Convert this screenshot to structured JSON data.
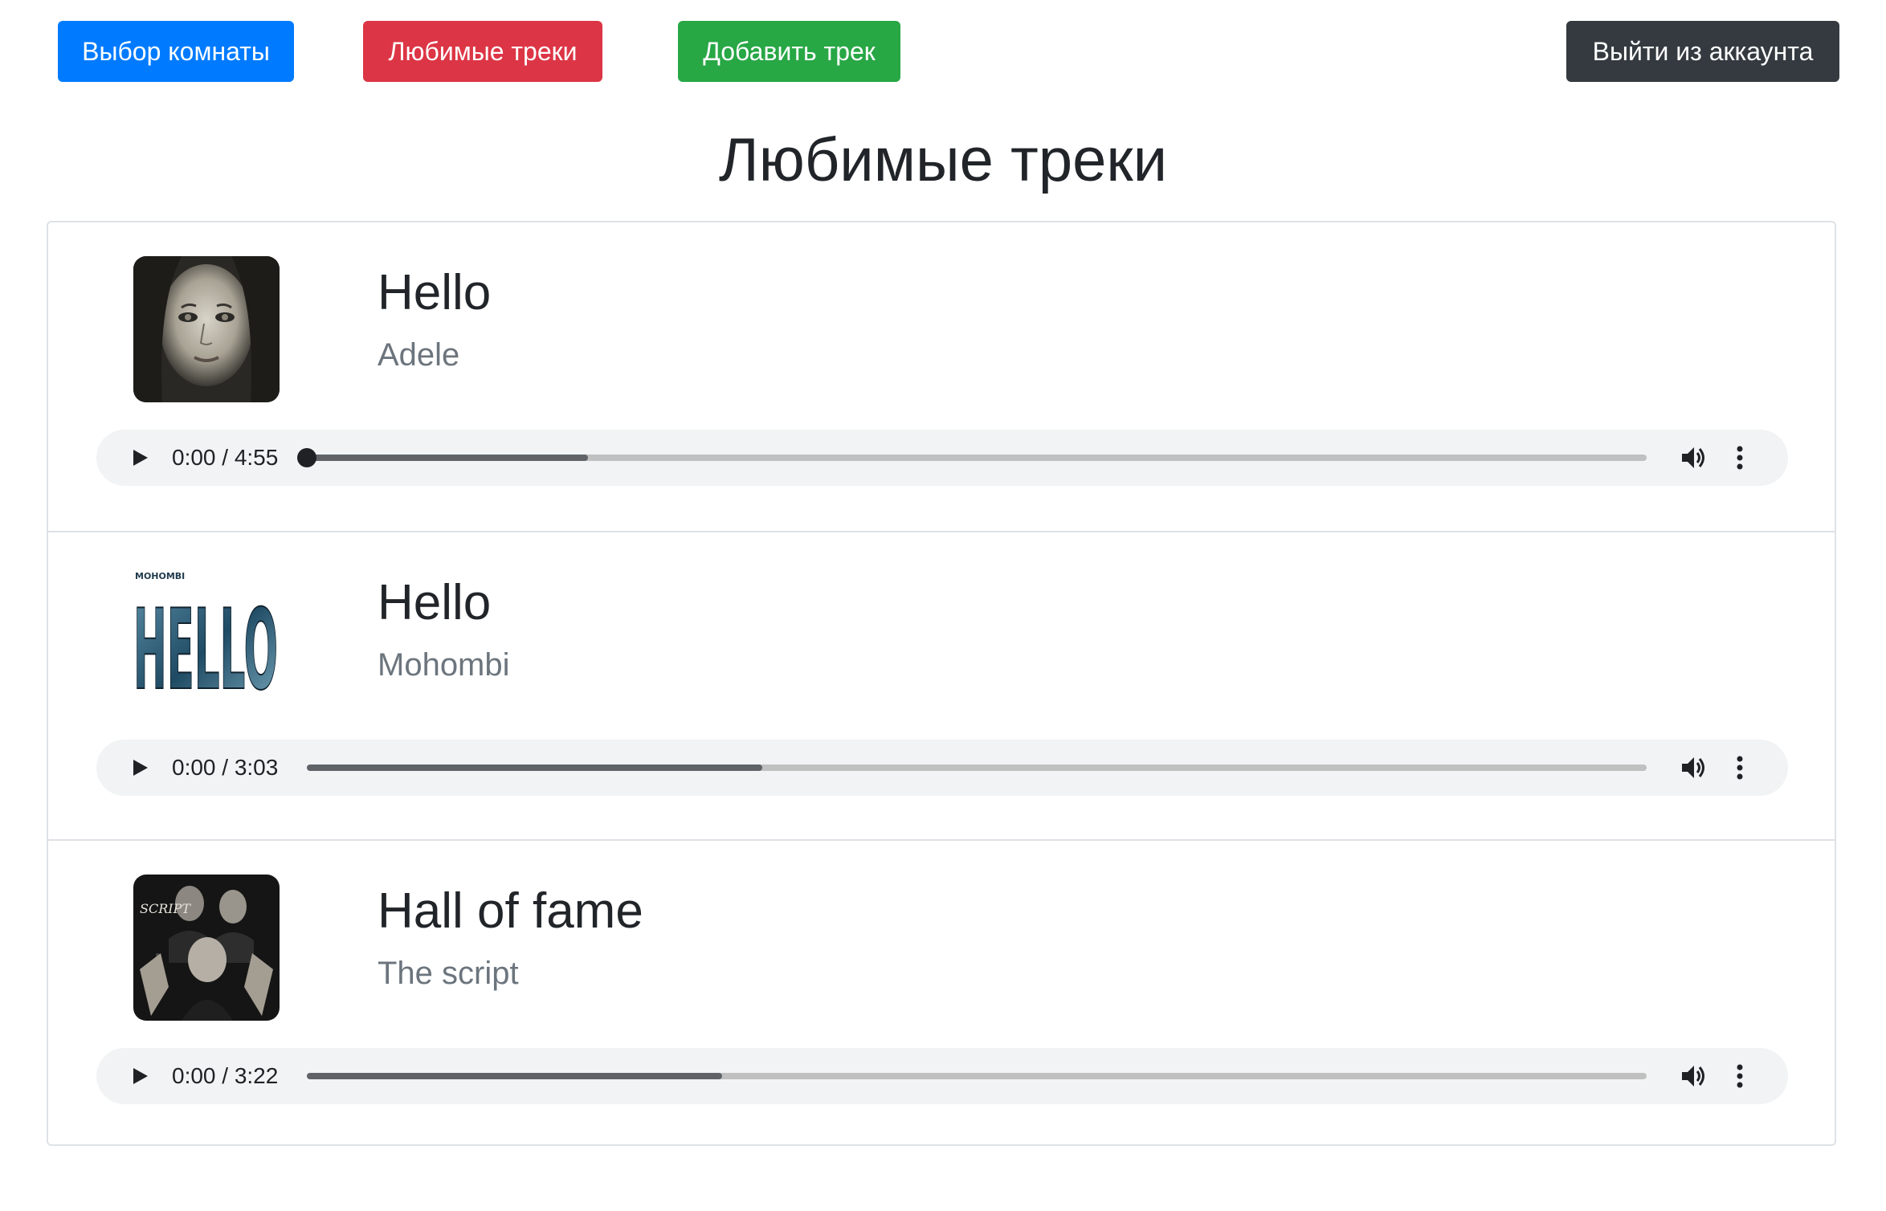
{
  "nav": {
    "room_select": "Выбор комнаты",
    "favorites": "Любимые треки",
    "add_track": "Добавить трек",
    "logout": "Выйти из аккаунта"
  },
  "colors": {
    "primary": "#007bff",
    "danger": "#dc3545",
    "success": "#28a745",
    "dark": "#343a40",
    "muted_text": "#6c757d",
    "player_bg": "#f1f3f4"
  },
  "page": {
    "title": "Любимые треки"
  },
  "tracks": [
    {
      "title": "Hello",
      "artist": "Adele",
      "time": "0:00 / 4:55",
      "buffered_fraction": 0.21,
      "cover_icon": "adele-portrait-cover",
      "cover_text": ""
    },
    {
      "title": "Hello",
      "artist": "Mohombi",
      "time": "0:00 / 3:03",
      "buffered_fraction": 0.34,
      "cover_icon": "hello-lettering-cover",
      "cover_text": "HELLO",
      "cover_subtext": "MOHOMBI"
    },
    {
      "title": "Hall of fame",
      "artist": "The script",
      "time": "0:00 / 3:22",
      "buffered_fraction": 0.31,
      "cover_icon": "the-script-band-cover",
      "cover_text": "SCRIPT"
    }
  ]
}
